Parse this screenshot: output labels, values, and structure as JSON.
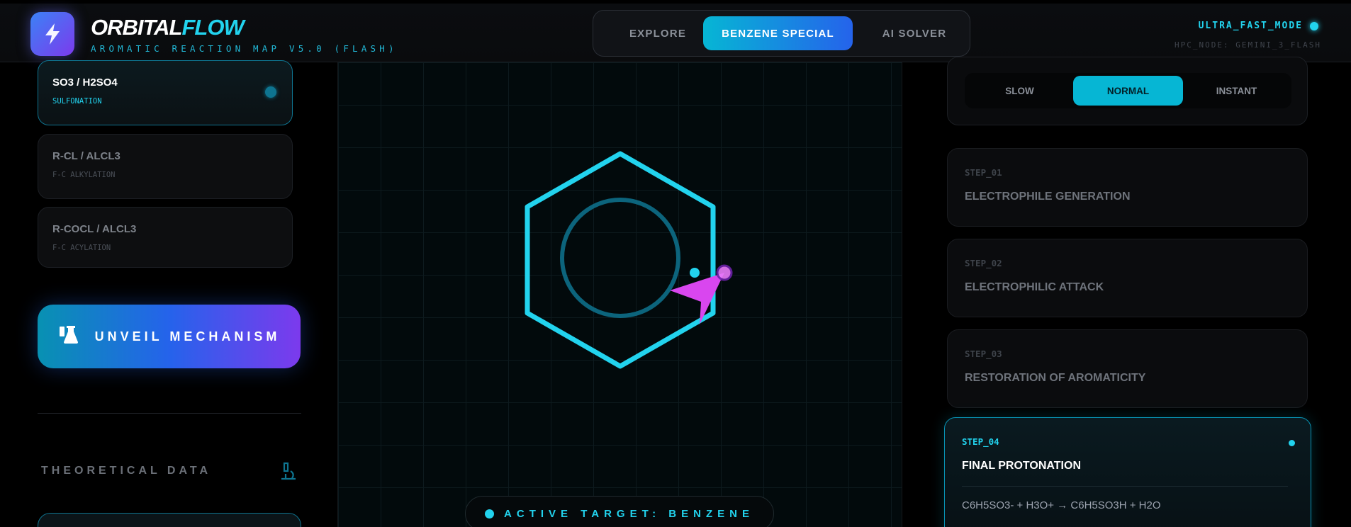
{
  "header": {
    "brand_part1": "ORBITAL",
    "brand_part2": "FLOW",
    "subtitle": "AROMATIC REACTION MAP V5.0 (FLASH)",
    "tabs": [
      {
        "label": "EXPLORE",
        "active": false
      },
      {
        "label": "BENZENE SPECIAL",
        "active": true
      },
      {
        "label": "AI SOLVER",
        "active": false
      }
    ],
    "mode_label": "ULTRA_FAST_MODE",
    "node_label": "HPC_NODE: GEMINI_3_FLASH"
  },
  "reagents": [
    {
      "title": "SO3 / H2SO4",
      "subtitle": "SULFONATION",
      "active": true
    },
    {
      "title": "R-CL / ALCL3",
      "subtitle": "F-C ALKYLATION",
      "active": false
    },
    {
      "title": "R-COCL / ALCL3",
      "subtitle": "F-C ACYLATION",
      "active": false
    }
  ],
  "unveil_label": "UNVEIL MECHANISM",
  "theoretical_label": "THEORETICAL DATA",
  "canvas": {
    "target_label": "ACTIVE TARGET: BENZENE"
  },
  "speed": {
    "options": [
      "SLOW",
      "NORMAL",
      "INSTANT"
    ],
    "selected": "NORMAL"
  },
  "steps": [
    {
      "label": "STEP_01",
      "title": "ELECTROPHILE GENERATION"
    },
    {
      "label": "STEP_02",
      "title": "ELECTROPHILIC ATTACK"
    },
    {
      "label": "STEP_03",
      "title": "RESTORATION OF AROMATICITY"
    },
    {
      "label": "STEP_04",
      "title": "FINAL PROTONATION",
      "equation": "C6H5SO3- + H3O+ → C6H5SO3H + H2O",
      "active": true
    }
  ],
  "colors": {
    "accent": "#22d3ee",
    "brand_gradient_start": "#06b6d4",
    "brand_gradient_end": "#7c3aed",
    "electrophile": "#d946ef"
  },
  "icons": {
    "logo": "lightning-bolt-icon",
    "unveil": "flask-icon",
    "theory": "microscope-icon"
  }
}
